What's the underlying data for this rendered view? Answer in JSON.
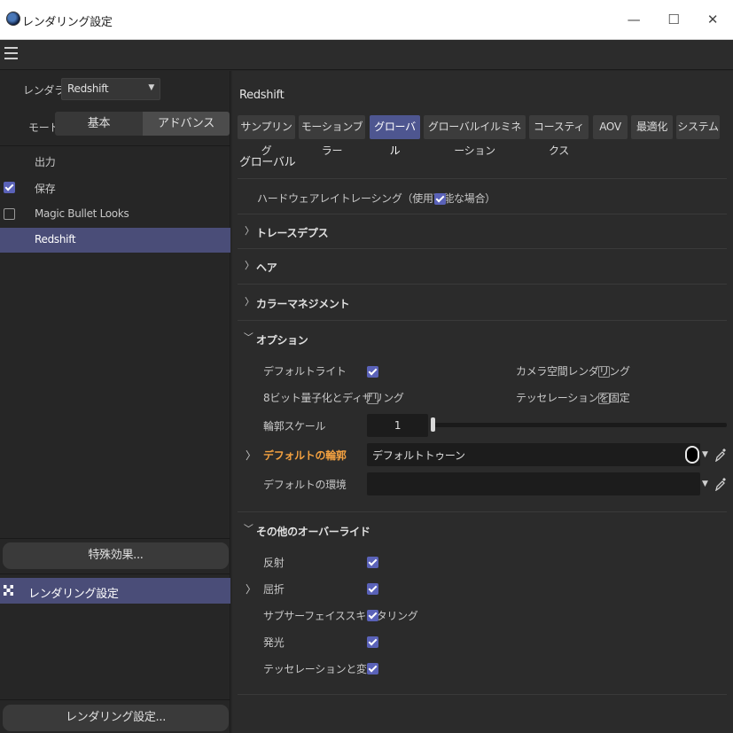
{
  "window": {
    "title": "レンダリング設定",
    "minimize": "—",
    "maximize": "☐",
    "close": "✕"
  },
  "icons": {
    "menu": "hamburger-menu-icon",
    "app": "cinema4d-app-icon",
    "render": "render-settings-icon",
    "picker": "eyedropper-icon"
  },
  "colors": {
    "accent": "#4e5690",
    "selection": "#4a4d78",
    "checkbox": "#5a62b8",
    "highlight_label": "#f2a040"
  },
  "left": {
    "renderer_label": "レンダラー",
    "renderer_value": "Redshift",
    "mode_label": "モード",
    "mode_basic": "基本",
    "mode_advanced": "アドバンス",
    "items": [
      {
        "label": "出力",
        "checkbox": "none"
      },
      {
        "label": "保存",
        "checkbox": "checked"
      },
      {
        "label": "Magic Bullet Looks",
        "checkbox": "unchecked"
      },
      {
        "label": "Redshift",
        "checkbox": "none",
        "selected": true
      }
    ],
    "effects_button": "特殊効果...",
    "render_settings_item": "レンダリング設定",
    "render_settings_button": "レンダリング設定..."
  },
  "right": {
    "header": "Redshift",
    "tabs": [
      "サンプリング",
      "モーションブラー",
      "グローバル",
      "グローバルイルミネーション",
      "コースティクス",
      "AOV",
      "最適化",
      "システム"
    ],
    "active_tab": "グローバル",
    "section_title": "グローバル",
    "hw_raytracing": {
      "label": "ハードウェアレイトレーシング（使用可能な場合）",
      "checked": true
    },
    "groups": {
      "trace_depth": "トレースデプス",
      "hair": "ヘア",
      "color_management": "カラーマネジメント",
      "options": "オプション",
      "overrides": "その他のオーバーライド"
    },
    "options": {
      "default_light": {
        "label": "デフォルトライト",
        "checked": true
      },
      "camera_space": {
        "label": "カメラ空間レンダリング",
        "checked": false
      },
      "dither": {
        "label": "8ビット量子化とディザリング",
        "checked": false
      },
      "fixed_tess": {
        "label": "テッセレーションを固定",
        "checked": false
      },
      "contour_scale": {
        "label": "輪郭スケール",
        "value": "1",
        "fraction": 0.0
      },
      "default_contour": {
        "label": "デフォルトの輪郭",
        "value": "デフォルトトゥーン"
      },
      "default_env": {
        "label": "デフォルトの環境",
        "value": ""
      }
    },
    "overrides": [
      {
        "label": "反射",
        "checked": true,
        "expand": false
      },
      {
        "label": "屈折",
        "checked": true,
        "expand": true
      },
      {
        "label": "サブサーフェイススキャタリング",
        "checked": true,
        "expand": false
      },
      {
        "label": "発光",
        "checked": true,
        "expand": false
      },
      {
        "label": "テッセレーションと変位",
        "checked": true,
        "expand": false
      }
    ]
  }
}
